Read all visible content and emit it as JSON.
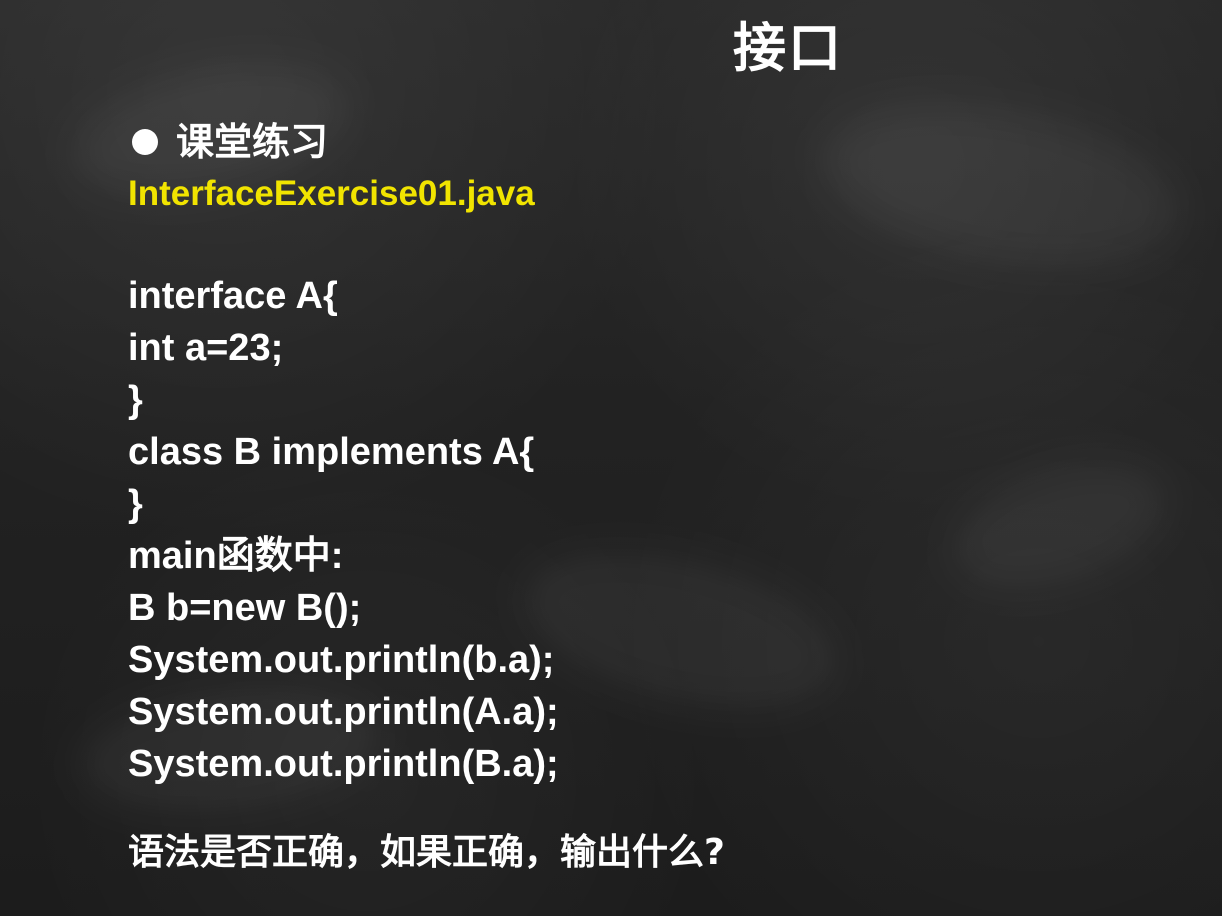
{
  "slide": {
    "title": "接口",
    "bullet": {
      "icon": "bullet-dot-icon",
      "label": "课堂练习"
    },
    "file_name": "InterfaceExercise01.java",
    "code_lines": [
      "interface A{",
      "int a=23;",
      "}",
      "class B implements A{",
      "}",
      "main函数中:",
      "B b=new B();",
      "System.out.println(b.a);",
      "System.out.println(A.a);",
      "System.out.println(B.a);"
    ],
    "question": "语法是否正确，如果正确，输出什么?",
    "colors": {
      "background": "#222222",
      "text": "#ffffff",
      "accent": "#f1e400"
    }
  }
}
